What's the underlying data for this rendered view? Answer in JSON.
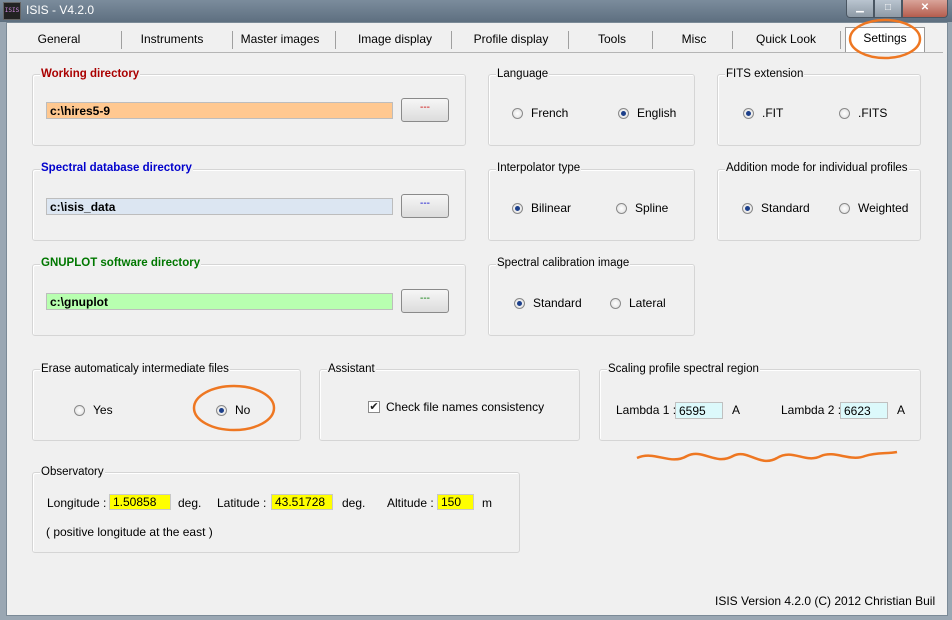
{
  "app": {
    "icon_text": "ISIS",
    "title": "ISIS - V4.2.0"
  },
  "colors": {
    "working_dir_label": "#aa0000",
    "working_dir_field": "#ffc890",
    "spectral_db_label": "#0000cc",
    "spectral_db_field": "#dce6f2",
    "gnuplot_label": "#007700",
    "gnuplot_field": "#b8ffb0",
    "annotation": "#ee7722"
  },
  "tabs": [
    {
      "label": "General"
    },
    {
      "label": "Instruments"
    },
    {
      "label": "Master images"
    },
    {
      "label": "Image display"
    },
    {
      "label": "Profile display"
    },
    {
      "label": "Tools"
    },
    {
      "label": "Misc"
    },
    {
      "label": "Quick Look"
    },
    {
      "label": "Settings",
      "active": true
    }
  ],
  "working_directory": {
    "label": "Working directory",
    "value": "c:\\hires5-9",
    "browse_label": "---"
  },
  "spectral_db": {
    "label": "Spectral database directory",
    "value": "c:\\isis_data",
    "browse_label": "---"
  },
  "gnuplot": {
    "label": "GNUPLOT software directory",
    "value": "c:\\gnuplot",
    "browse_label": "---"
  },
  "language": {
    "label": "Language",
    "options": [
      "French",
      "English"
    ],
    "selected": "English"
  },
  "fits_extension": {
    "label": "FITS extension",
    "options": [
      ".FIT",
      ".FITS"
    ],
    "selected": ".FIT"
  },
  "interpolator": {
    "label": "Interpolator type",
    "options": [
      "Bilinear",
      "Spline"
    ],
    "selected": "Bilinear"
  },
  "addition_mode": {
    "label": "Addition mode for individual profiles",
    "options": [
      "Standard",
      "Weighted"
    ],
    "selected": "Standard"
  },
  "calibration_image": {
    "label": "Spectral calibration image",
    "options": [
      "Standard",
      "Lateral"
    ],
    "selected": "Standard"
  },
  "erase_files": {
    "label": "Erase automaticaly intermediate files",
    "options": [
      "Yes",
      "No"
    ],
    "selected": "No"
  },
  "assistant": {
    "label": "Assistant",
    "checkbox_label": "Check file names consistency",
    "checked": true
  },
  "scaling": {
    "label": "Scaling profile spectral region",
    "lambda1_label": "Lambda 1 :",
    "lambda1": "6595",
    "lambda2_label": "Lambda 2 :",
    "lambda2": "6623",
    "unit": "A"
  },
  "observatory": {
    "label": "Observatory",
    "longitude_label": "Longitude :",
    "longitude": "1.50858",
    "longitude_unit": "deg.",
    "latitude_label": "Latitude :",
    "latitude": "43.51728",
    "latitude_unit": "deg.",
    "altitude_label": "Altitude :",
    "altitude": "150",
    "altitude_unit": "m",
    "note": "( positive longitude at the east )"
  },
  "footer": {
    "version": "ISIS Version 4.2.0 (C) 2012 Christian Buil"
  }
}
